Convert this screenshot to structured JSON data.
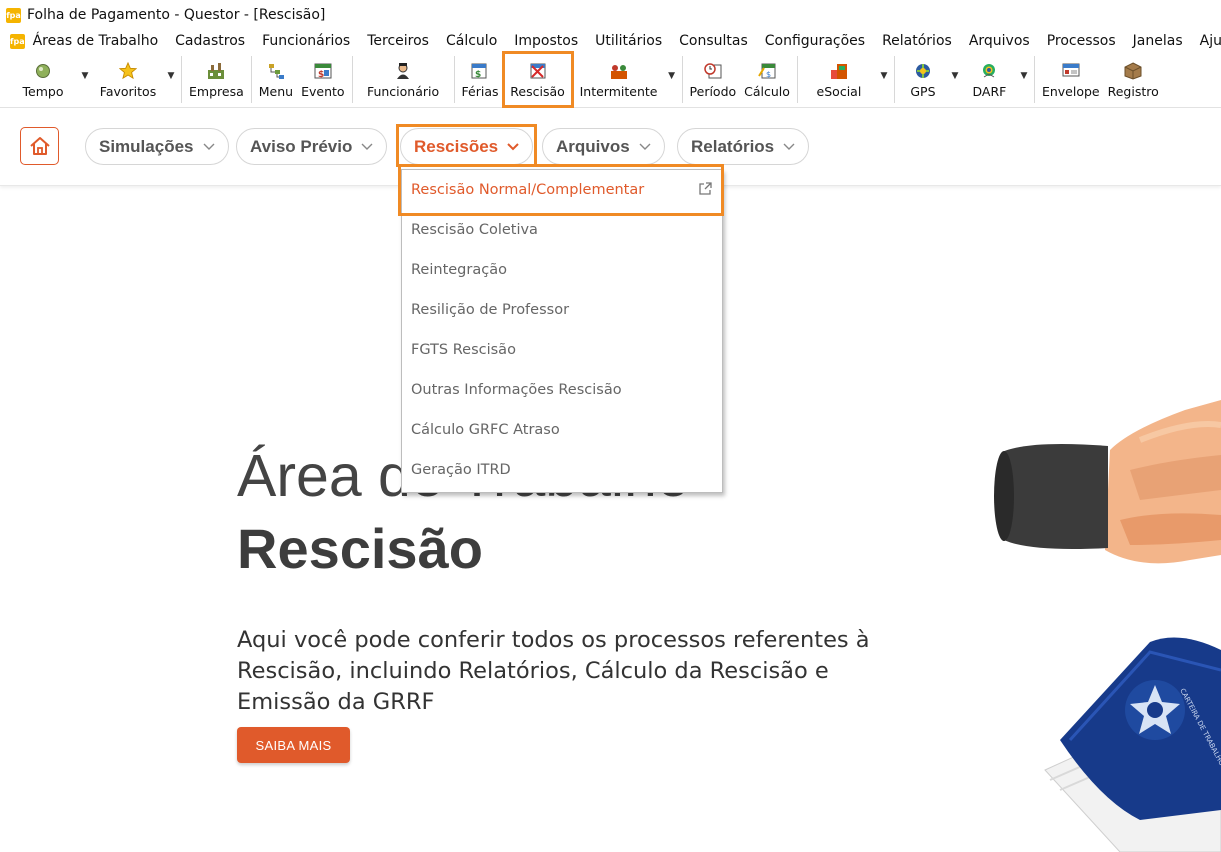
{
  "window": {
    "app_icon_text": "fpa",
    "title": "Folha de Pagamento - Questor - [Rescisão]"
  },
  "menubar": {
    "items": [
      "Áreas de Trabalho",
      "Cadastros",
      "Funcionários",
      "Terceiros",
      "Cálculo",
      "Impostos",
      "Utilitários",
      "Consultas",
      "Configurações",
      "Relatórios",
      "Arquivos",
      "Processos",
      "Janelas",
      "Ajuda"
    ]
  },
  "toolbar": {
    "tempo": "Tempo",
    "favoritos": "Favoritos",
    "empresa": "Empresa",
    "menu": "Menu",
    "evento": "Evento",
    "funcionario": "Funcionário",
    "ferias": "Férias",
    "rescisao": "Rescisão",
    "intermitente": "Intermitente",
    "periodo": "Período",
    "calculo": "Cálculo",
    "esocial": "eSocial",
    "gps": "GPS",
    "darf": "DARF",
    "envelope": "Envelope",
    "registro": "Registro"
  },
  "nav": {
    "simulacoes": "Simulações",
    "aviso_previo": "Aviso Prévio",
    "rescisoes": "Rescisões",
    "arquivos": "Arquivos",
    "relatorios": "Relatórios"
  },
  "dropdown": {
    "items": [
      "Rescisão Normal/Complementar",
      "Rescisão Coletiva",
      "Reintegração",
      "Resilição de Professor",
      "FGTS Rescisão",
      "Outras Informações Rescisão",
      "Cálculo GRFC Atraso",
      "Geração ITRD"
    ]
  },
  "hero": {
    "title_line1": "Área de Trabalho",
    "title_line2": "Rescisão",
    "description": "Aqui você pode conferir todos os processos referentes à Rescisão, incluindo Relatórios, Cálculo da Rescisão e Emissão da GRRF",
    "cta": "SAIBA MAIS"
  },
  "colors": {
    "accent": "#e05a2b",
    "highlight": "#f08a24"
  }
}
